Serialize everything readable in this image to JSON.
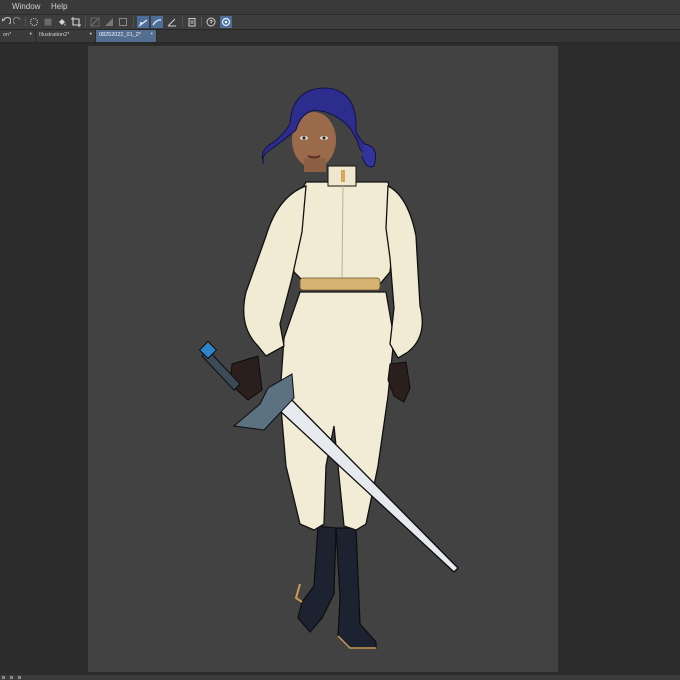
{
  "menubar": {
    "window_label": "Window",
    "help_label": "Help"
  },
  "tabs": [
    {
      "label": "on*"
    },
    {
      "label": "Illustration2*"
    },
    {
      "label": "08252022_01_2*"
    }
  ],
  "icons": {
    "undo": "undo-icon",
    "redo": "redo-icon",
    "transform": "transform-icon",
    "fill": "fill-icon",
    "crop": "crop-icon",
    "snap": "snap-icon",
    "ruler": "ruler-icon",
    "clip": "clip-icon",
    "settings": "settings-icon"
  },
  "colors": {
    "active_tab": "#546e92",
    "active_tool": "#4d6e98",
    "canvas": "#424242",
    "workspace": "#2c2c2c"
  }
}
